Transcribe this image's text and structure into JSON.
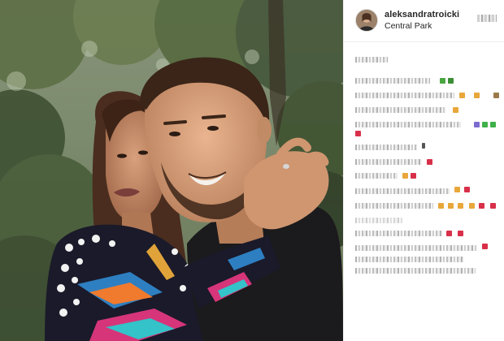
{
  "post": {
    "username": "aleksandratroicki",
    "location": "Central Park"
  },
  "icons": {
    "avatar": "profile-avatar-icon",
    "follow": "follow-button-blurred"
  },
  "colors": {
    "panel_bg": "#ffffff",
    "text": "#262626",
    "divider": "#efefef"
  }
}
